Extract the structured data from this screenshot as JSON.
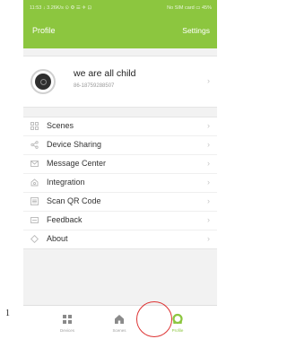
{
  "status_bar": {
    "left": "11:53 ↓ 3.26K/s ⊙ ⚙ ☰ ✈ ⊡",
    "right": "No SIM card ▭ 45%"
  },
  "header": {
    "title": "Profile",
    "settings_label": "Settings"
  },
  "profile": {
    "name": "we are all child",
    "phone": "86-18759288507"
  },
  "menu": {
    "items": [
      {
        "label": "Scenes",
        "icon": "grid-icon"
      },
      {
        "label": "Device Sharing",
        "icon": "share-icon"
      },
      {
        "label": "Message Center",
        "icon": "message-icon"
      },
      {
        "label": "Integration",
        "icon": "integration-icon"
      },
      {
        "label": "Scan QR Code",
        "icon": "qr-icon"
      },
      {
        "label": "Feedback",
        "icon": "feedback-icon"
      },
      {
        "label": "About",
        "icon": "about-icon"
      }
    ]
  },
  "bottom_nav": {
    "items": [
      {
        "label": "Devices",
        "icon": "grid-icon"
      },
      {
        "label": "Scenes",
        "icon": "home-icon"
      },
      {
        "label": "Profile",
        "icon": "profile-icon"
      }
    ]
  },
  "annotation": {
    "number": "1"
  },
  "colors": {
    "accent": "#8cc63f",
    "highlight": "#dd3333"
  }
}
